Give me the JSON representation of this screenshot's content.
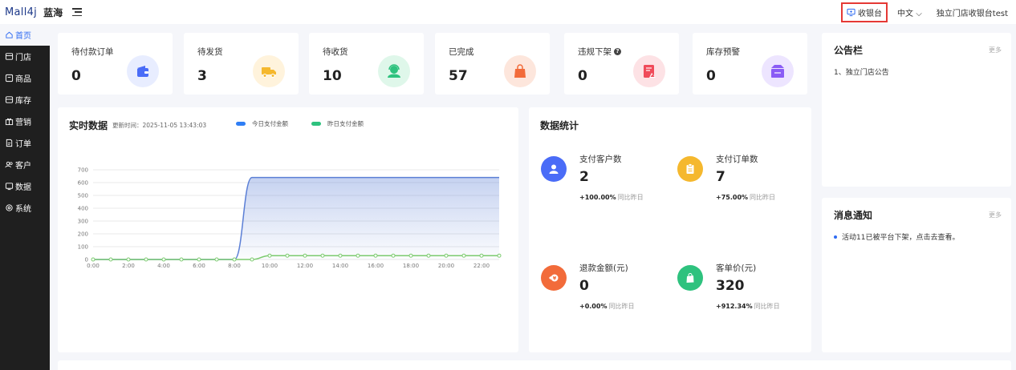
{
  "header": {
    "logo": "Mall4j",
    "brand": "蓝海",
    "cashier_label": "收银台",
    "language": "中文",
    "store_name": "独立门店收银台test"
  },
  "sidebar": {
    "items": [
      {
        "label": "首页",
        "icon": "home-icon",
        "active": true
      },
      {
        "label": "门店",
        "icon": "store-icon"
      },
      {
        "label": "商品",
        "icon": "product-icon"
      },
      {
        "label": "库存",
        "icon": "inventory-icon"
      },
      {
        "label": "营销",
        "icon": "gift-icon"
      },
      {
        "label": "订单",
        "icon": "order-icon"
      },
      {
        "label": "客户",
        "icon": "customer-icon"
      },
      {
        "label": "数据",
        "icon": "data-icon"
      },
      {
        "label": "系统",
        "icon": "settings-icon"
      }
    ]
  },
  "stats": [
    {
      "label": "待付款订单",
      "value": "0",
      "icon": "wallet-icon",
      "color": "#4a6cf7",
      "bg": "#e8edff"
    },
    {
      "label": "待发货",
      "value": "3",
      "icon": "truck-icon",
      "color": "#f5b82e",
      "bg": "#fff3dc"
    },
    {
      "label": "待收货",
      "value": "10",
      "icon": "receiver-icon",
      "color": "#2ec27e",
      "bg": "#dff7ea"
    },
    {
      "label": "已完成",
      "value": "57",
      "icon": "bag-icon",
      "color": "#f26b3a",
      "bg": "#fde6dc"
    },
    {
      "label": "违规下架",
      "value": "0",
      "icon": "violation-icon",
      "color": "#f04b5a",
      "bg": "#fde2e5",
      "help": "?"
    },
    {
      "label": "库存预警",
      "value": "0",
      "icon": "box-icon",
      "color": "#8a5cf5",
      "bg": "#ede5ff"
    }
  ],
  "notice": {
    "title": "公告栏",
    "more": "更多",
    "items": [
      "1、独立门店公告"
    ]
  },
  "messages": {
    "title": "消息通知",
    "more": "更多",
    "items": [
      "活动11已被平台下架，点击去查看。"
    ]
  },
  "realtime": {
    "title": "实时数据",
    "updated_label": "更新时间：2025-11-05  13:43:03"
  },
  "data_stats": {
    "title": "数据统计",
    "metrics": [
      {
        "label": "支付客户数",
        "value": "2",
        "change": "+100.00%",
        "compare": "同比昨日",
        "icon": "user-icon",
        "color": "#4a6cf7"
      },
      {
        "label": "支付订单数",
        "value": "7",
        "change": "+75.00%",
        "compare": "同比昨日",
        "icon": "clipboard-icon",
        "color": "#f5b82e"
      },
      {
        "label": "退款金额(元)",
        "value": "0",
        "change": "+0.00%",
        "compare": "同比昨日",
        "icon": "refund-icon",
        "color": "#f26b3a"
      },
      {
        "label": "客单价(元)",
        "value": "320",
        "change": "+912.34%",
        "compare": "同比昨日",
        "icon": "shopping-bag-icon",
        "color": "#2ec27e"
      }
    ]
  },
  "chart_data": {
    "type": "line",
    "title": "",
    "x": [
      "0:00",
      "1:00",
      "2:00",
      "3:00",
      "4:00",
      "5:00",
      "6:00",
      "7:00",
      "8:00",
      "9:00",
      "10:00",
      "11:00",
      "12:00",
      "13:00",
      "14:00",
      "15:00",
      "16:00",
      "17:00",
      "18:00",
      "19:00",
      "20:00",
      "21:00",
      "22:00",
      "23:00"
    ],
    "xticks": [
      "0:00",
      "2:00",
      "4:00",
      "6:00",
      "8:00",
      "10:00",
      "12:00",
      "14:00",
      "16:00",
      "18:00",
      "20:00",
      "22:00"
    ],
    "yticks": [
      0,
      100,
      200,
      300,
      400,
      500,
      600,
      700
    ],
    "ylim": [
      0,
      700
    ],
    "series": [
      {
        "name": "今日支付金额",
        "color": "#5b7fd6",
        "values": [
          0,
          0,
          0,
          0,
          0,
          0,
          0,
          0,
          0,
          640,
          640,
          640,
          640,
          640,
          640,
          640,
          640,
          640,
          640,
          640,
          640,
          640,
          640,
          640
        ]
      },
      {
        "name": "昨日支付金额",
        "color": "#7ccb6f",
        "values": [
          0,
          0,
          0,
          0,
          0,
          0,
          0,
          0,
          0,
          0,
          30,
          30,
          30,
          30,
          30,
          30,
          30,
          30,
          30,
          30,
          30,
          30,
          30,
          30
        ]
      }
    ],
    "legend_position": "top",
    "grid": true
  }
}
